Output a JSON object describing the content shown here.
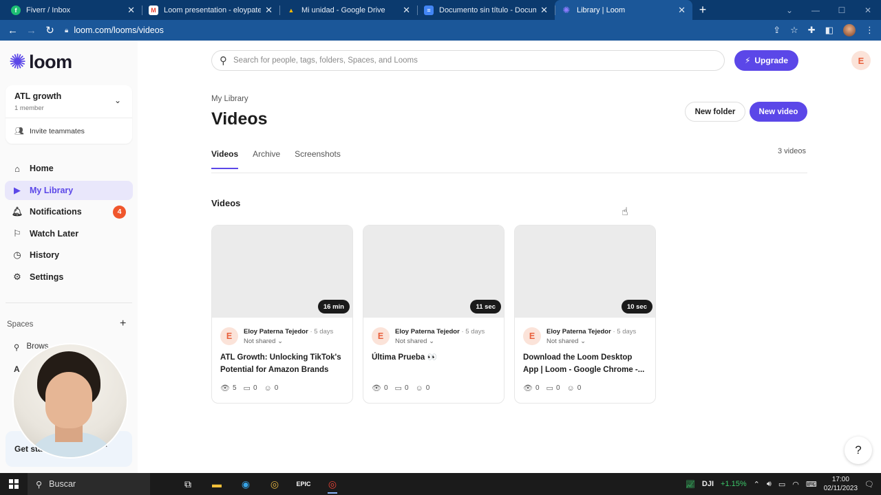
{
  "browser": {
    "tabs": [
      {
        "title": "Fiverr / Inbox",
        "fav": "fiverr-icon",
        "fav_color": "#1dbf73",
        "active": false
      },
      {
        "title": "Loom presentation - eloypaterna",
        "fav": "gmail-icon",
        "fav_color": "#ea4335",
        "active": false
      },
      {
        "title": "Mi unidad - Google Drive",
        "fav": "drive-icon",
        "fav_color": "#34a853",
        "active": false
      },
      {
        "title": "Documento sin título - Documen",
        "fav": "docs-icon",
        "fav_color": "#4285f4",
        "active": false
      },
      {
        "title": "Library | Loom",
        "fav": "loom-icon",
        "fav_color": "#5b47e8",
        "active": true
      }
    ],
    "url": "loom.com/looms/videos"
  },
  "sidebar": {
    "logo_text": "loom",
    "workspace": {
      "name": "ATL growth",
      "members": "1 member",
      "invite": "Invite teammates"
    },
    "nav": [
      {
        "label": "Home",
        "icon": "home-icon"
      },
      {
        "label": "My Library",
        "icon": "library-icon",
        "active": true
      },
      {
        "label": "Notifications",
        "icon": "bell-icon",
        "badge": "4"
      },
      {
        "label": "Watch Later",
        "icon": "bookmark-icon"
      },
      {
        "label": "History",
        "icon": "clock-icon"
      },
      {
        "label": "Settings",
        "icon": "gear-icon"
      }
    ],
    "spaces_label": "Spaces",
    "browse_label": "Brows",
    "space_initial": "A",
    "get_started": "Get sta"
  },
  "header": {
    "search_placeholder": "Search for people, tags, folders, Spaces, and Looms",
    "upgrade_label": "Upgrade",
    "avatar_initial": "E"
  },
  "library": {
    "breadcrumb": "My Library",
    "title": "Videos",
    "new_folder": "New folder",
    "new_video": "New video",
    "tabs": [
      "Videos",
      "Archive",
      "Screenshots"
    ],
    "count": "3 videos",
    "section": "Videos",
    "videos": [
      {
        "duration": "16 min",
        "owner": "Eloy Paterna Tejedor",
        "ago": "5 days",
        "share": "Not shared",
        "title": "ATL Growth: Unlocking TikTok's Potential for Amazon Brands",
        "views": "5",
        "comments": "0",
        "reactions": "0",
        "initial": "E"
      },
      {
        "duration": "11 sec",
        "owner": "Eloy Paterna Tejedor",
        "ago": "5 days",
        "share": "Not shared",
        "title": "Última Prueba 👀",
        "views": "0",
        "comments": "0",
        "reactions": "0",
        "initial": "E"
      },
      {
        "duration": "10 sec",
        "owner": "Eloy Paterna Tejedor",
        "ago": "5 days",
        "share": "Not shared",
        "title": "Download the Loom Desktop App | Loom - Google Chrome -...",
        "views": "0",
        "comments": "0",
        "reactions": "0",
        "initial": "E"
      }
    ]
  },
  "help_label": "?",
  "taskbar": {
    "search": "Buscar",
    "ticker": "DJI",
    "ticker_change": "+1.15%",
    "time": "17:00",
    "date": "02/11/2023"
  }
}
